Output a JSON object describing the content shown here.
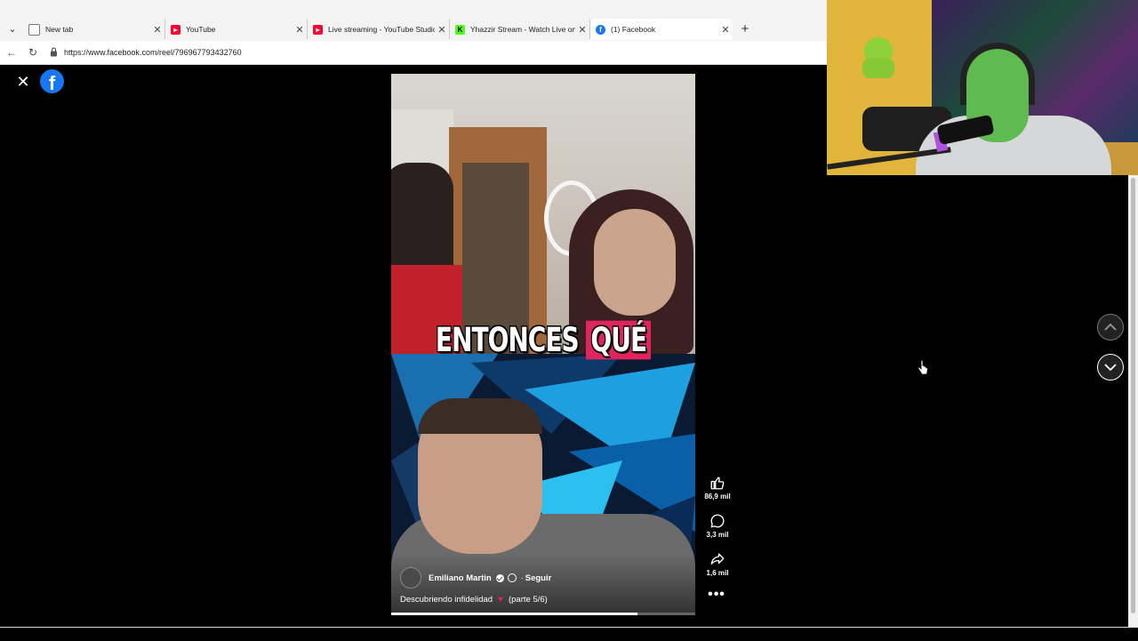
{
  "browser": {
    "tabs": [
      {
        "title": "New tab",
        "icon": "newtab-page-icon"
      },
      {
        "title": "YouTube",
        "icon": "youtube-icon"
      },
      {
        "title": "Live streaming - YouTube Studio",
        "icon": "youtube-studio-icon"
      },
      {
        "title": "Yhazzir Stream - Watch Live on Ki",
        "icon": "kick-icon"
      },
      {
        "title": "(1) Facebook",
        "icon": "facebook-icon",
        "active": true
      }
    ],
    "url": "https://www.facebook.com/reel/796967793432760",
    "new_tab_symbol": "+"
  },
  "reel": {
    "caption_part1": "ENTONCES",
    "caption_part2": "QUÉ",
    "author": "Emiliano Martin",
    "follow_separator": "·",
    "follow_label": "Seguir",
    "description_text": "Descubriendo infidelidad",
    "description_emoji": "♥",
    "description_part": "(parte 5/6)",
    "progress_fraction": 0.81,
    "likes": "86,9 mil",
    "comments": "3,3 mil",
    "shares": "1,6 mil",
    "more_label": "•••",
    "close_symbol": "✕",
    "logo_letter": "f"
  },
  "colors": {
    "facebook_blue": "#1877f2",
    "caption_highlight": "#e0245e",
    "background": "#000000"
  }
}
